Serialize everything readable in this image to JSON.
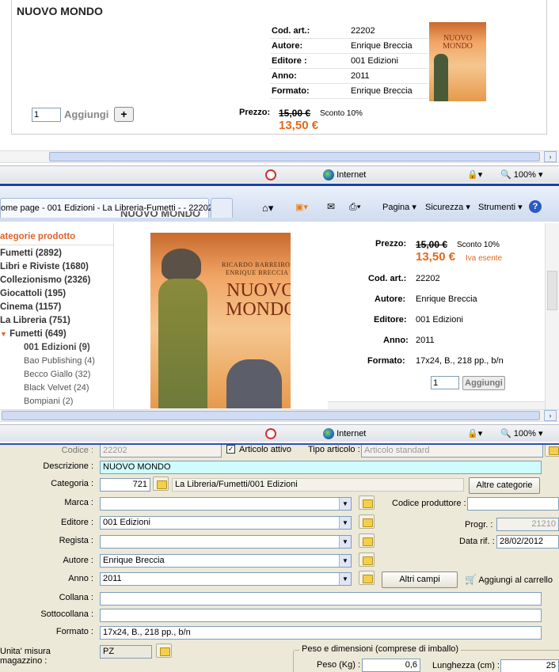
{
  "panel1": {
    "title": "NUOVO MONDO",
    "specs": [
      {
        "label": "Cod. art.:",
        "value": "22202"
      },
      {
        "label": "Autore:",
        "value": "Enrique Breccia"
      },
      {
        "label": "Editore :",
        "value": "001 Edizioni"
      },
      {
        "label": "Anno:",
        "value": "2011"
      },
      {
        "label": "Formato:",
        "value": "Enrique Breccia"
      }
    ],
    "qty": "1",
    "add_label": "Aggiungi",
    "plus": "+",
    "price_label": "Prezzo:",
    "old_price": "15,00 €",
    "discount": "Sconto 10%",
    "new_price": "13,50 €",
    "cover_title": "NUOVO MONDO",
    "status_zone": "Internet",
    "zoom": "100%"
  },
  "panel2": {
    "tab_title": "ome page - 001 Edizioni - La Libreria-Fumetti - - 22202",
    "toolbar": {
      "page": "Pagina",
      "security": "Sicurezza",
      "tools": "Strumenti"
    },
    "clipped_title": "NUOVO MONDO",
    "categories_header": "ategorie prodotto",
    "categories": [
      "Fumetti (2892)",
      "Libri e Riviste (1680)",
      "Collezionismo (2326)",
      "Giocattoli (195)",
      "Cinema (1157)",
      "La Libreria (751)"
    ],
    "expanded": "Fumetti (649)",
    "selected_sub": "001 Edizioni (9)",
    "subs": [
      "Bao Publishing (4)",
      "Becco Giallo (32)",
      "Black Velvet (24)",
      "Bompiani (2)"
    ],
    "cover": {
      "authors": [
        "RICARDO BARREIRO",
        "ENRIQUE BRECCIA"
      ],
      "title1": "NUOVO",
      "title2": "MONDO"
    },
    "price_label": "Prezzo:",
    "old_price": "15,00 €",
    "discount": "Sconto 10%",
    "new_price": "13,50 €",
    "vat": "Iva esente",
    "specs": [
      {
        "label": "Cod. art.:",
        "value": "22202"
      },
      {
        "label": "Autore:",
        "value": "Enrique Breccia"
      },
      {
        "label": "Editore:",
        "value": "001 Edizioni"
      },
      {
        "label": "Anno:",
        "value": "2011"
      },
      {
        "label": "Formato:",
        "value": "17x24, B., 218 pp., b/n"
      }
    ],
    "qty": "1",
    "add_label": "Aggiungi",
    "status_zone": "Internet",
    "zoom": "100%"
  },
  "panel3": {
    "codice_label": "Codice :",
    "codice": "22202",
    "attivo_label": "Articolo attivo",
    "tipo_label": "Tipo articolo :",
    "tipo": "Articolo standard",
    "descrizione_label": "Descrizione :",
    "descrizione": "NUOVO MONDO",
    "categoria_label": "Categoria :",
    "categoria_id": "721",
    "categoria_path": "La Libreria/Fumetti/001 Edizioni",
    "altre_categorie": "Altre categorie",
    "marca_label": "Marca :",
    "marca": "",
    "codice_produttore_label": "Codice produttore :",
    "editore_label": "Editore :",
    "editore": "001 Edizioni",
    "progr_label": "Progr. :",
    "progr": "21210",
    "regista_label": "Regista :",
    "regista": "",
    "data_label": "Data rif. :",
    "data": "28/02/2012",
    "autore_label": "Autore :",
    "autore": "Enrique Breccia",
    "anno_label": "Anno :",
    "anno": "2011",
    "altri_campi": "Altri campi",
    "carrello": "Aggiungi al carrello",
    "collana_label": "Collana :",
    "sottocollana_label": "Sottocollana :",
    "formato_label": "Formato :",
    "formato": "17x24, B., 218 pp., b/n",
    "unita_label": "Unita' misura magazzino :",
    "unita": "PZ",
    "peso_group": "Peso e dimensioni (comprese di imballo)",
    "peso_label": "Peso (Kg) :",
    "peso": "0,6",
    "lunghezza_label": "Lunghezza (cm) :",
    "lunghezza": "25"
  }
}
